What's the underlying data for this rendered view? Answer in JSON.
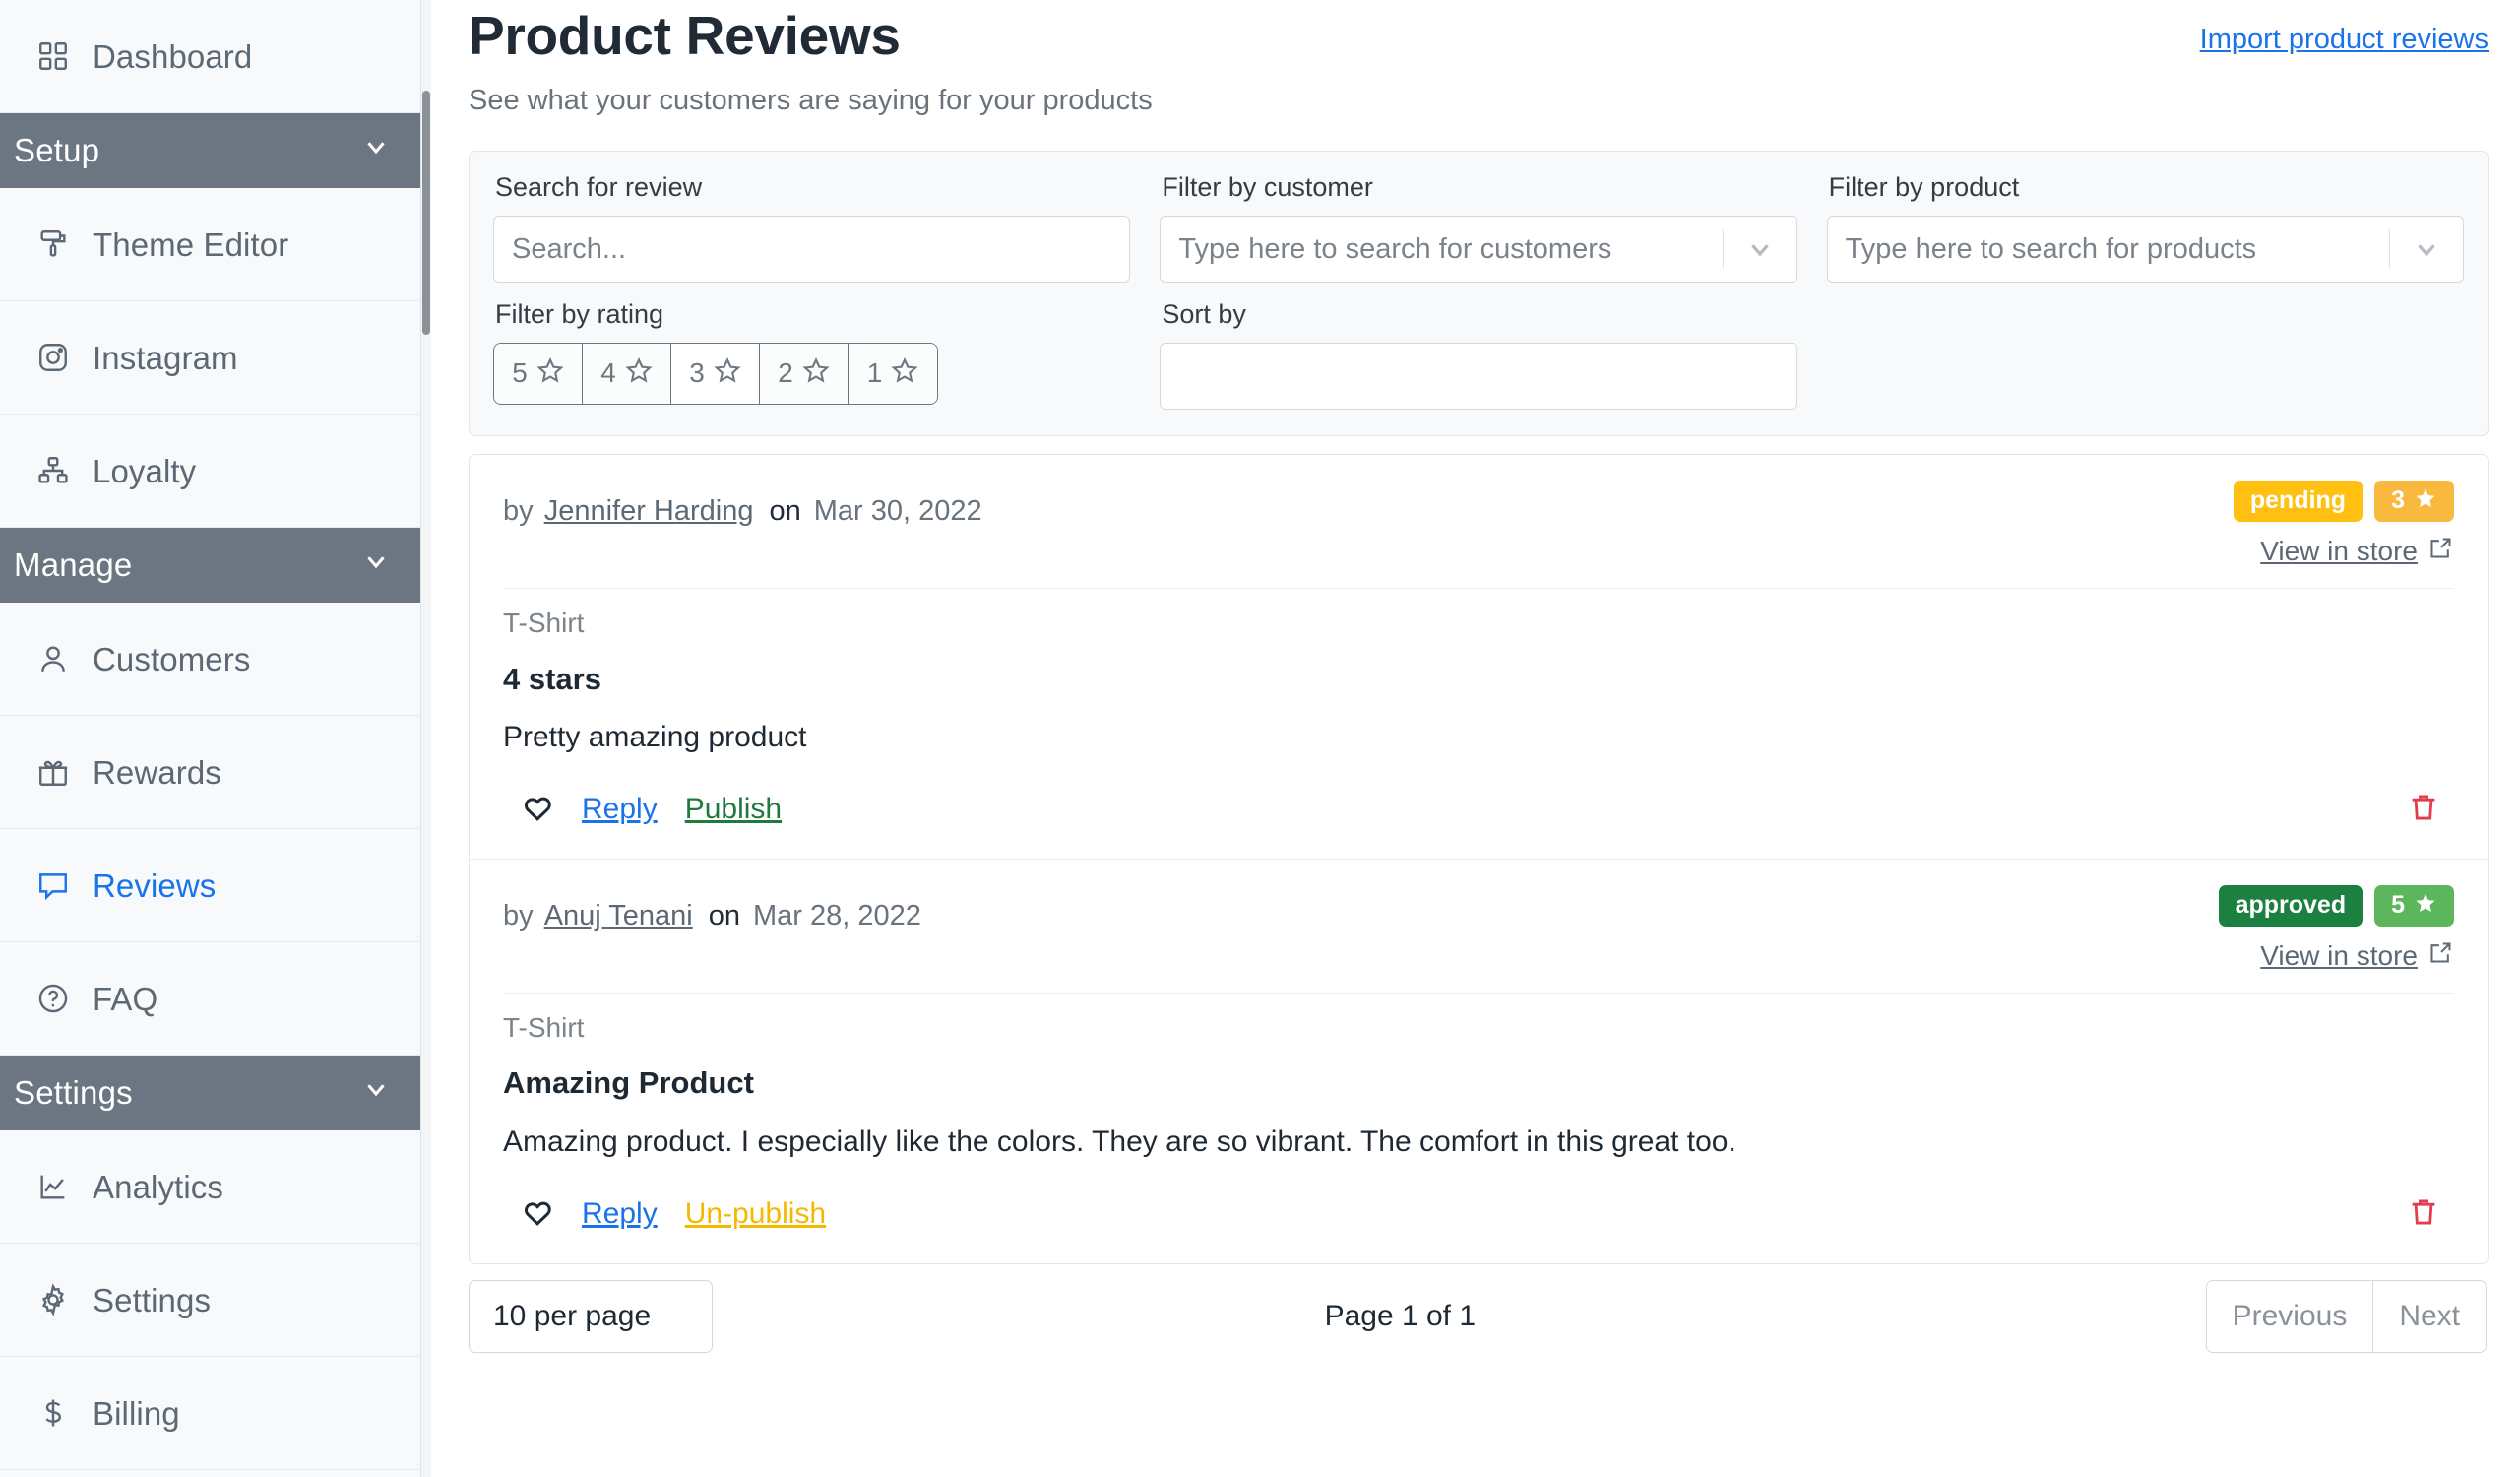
{
  "sidebar": {
    "items": [
      {
        "type": "link",
        "label": "Dashboard",
        "icon": "grid-icon",
        "active": false
      },
      {
        "type": "section",
        "label": "Setup",
        "icon": "chevron-down-icon"
      },
      {
        "type": "link",
        "label": "Theme Editor",
        "icon": "paint-roller-icon",
        "active": false
      },
      {
        "type": "link",
        "label": "Instagram",
        "icon": "instagram-icon",
        "active": false
      },
      {
        "type": "link",
        "label": "Loyalty",
        "icon": "hierarchy-icon",
        "active": false
      },
      {
        "type": "section",
        "label": "Manage",
        "icon": "chevron-down-icon"
      },
      {
        "type": "link",
        "label": "Customers",
        "icon": "user-icon",
        "active": false
      },
      {
        "type": "link",
        "label": "Rewards",
        "icon": "gift-icon",
        "active": false
      },
      {
        "type": "link",
        "label": "Reviews",
        "icon": "chat-bubble-icon",
        "active": true
      },
      {
        "type": "link",
        "label": "FAQ",
        "icon": "question-circle-icon",
        "active": false
      },
      {
        "type": "section",
        "label": "Settings",
        "icon": "chevron-down-icon"
      },
      {
        "type": "link",
        "label": "Analytics",
        "icon": "line-chart-icon",
        "active": false
      },
      {
        "type": "link",
        "label": "Settings",
        "icon": "gear-icon",
        "active": false
      },
      {
        "type": "link",
        "label": "Billing",
        "icon": "dollar-icon",
        "active": false
      }
    ]
  },
  "header": {
    "title": "Product Reviews",
    "subtitle": "See what your customers are saying for your products",
    "import_link": "Import product reviews"
  },
  "filters": {
    "search": {
      "label": "Search for review",
      "placeholder": "Search...",
      "value": ""
    },
    "customer": {
      "label": "Filter by customer",
      "placeholder": "Type here to search for customers",
      "value": ""
    },
    "product": {
      "label": "Filter by product",
      "placeholder": "Type here to search for products",
      "value": ""
    },
    "rating": {
      "label": "Filter by rating",
      "options": [
        "5",
        "4",
        "3",
        "2",
        "1"
      ],
      "selected": null
    },
    "sort": {
      "label": "Sort by",
      "value": ""
    }
  },
  "reviews": [
    {
      "by_prefix": "by",
      "author": "Jennifer Harding",
      "on_word": "on",
      "date": "Mar 30, 2022",
      "product": "T-Shirt",
      "title": "4 stars",
      "body": "Pretty amazing product",
      "status_badge": "pending",
      "status_color": "#ffc011",
      "rating_value": "3",
      "rating_color": "#f9b93e",
      "view_in_store": "View in store",
      "actions": {
        "reply": "Reply",
        "toggle": "Publish",
        "toggle_kind": "publish"
      }
    },
    {
      "by_prefix": "by",
      "author": "Anuj Tenani",
      "on_word": "on",
      "date": "Mar 28, 2022",
      "product": "T-Shirt",
      "title": "Amazing Product",
      "body": "Amazing product. I especially like the colors. They are so vibrant. The comfort in this great too.",
      "status_badge": "approved",
      "status_color": "#1c8040",
      "rating_value": "5",
      "rating_color": "#5cb75c",
      "view_in_store": "View in store",
      "actions": {
        "reply": "Reply",
        "toggle": "Un-publish",
        "toggle_kind": "unpublish"
      }
    }
  ],
  "pagination": {
    "per_page": "10 per page",
    "page_indicator": "Page 1 of 1",
    "previous": "Previous",
    "next": "Next"
  }
}
